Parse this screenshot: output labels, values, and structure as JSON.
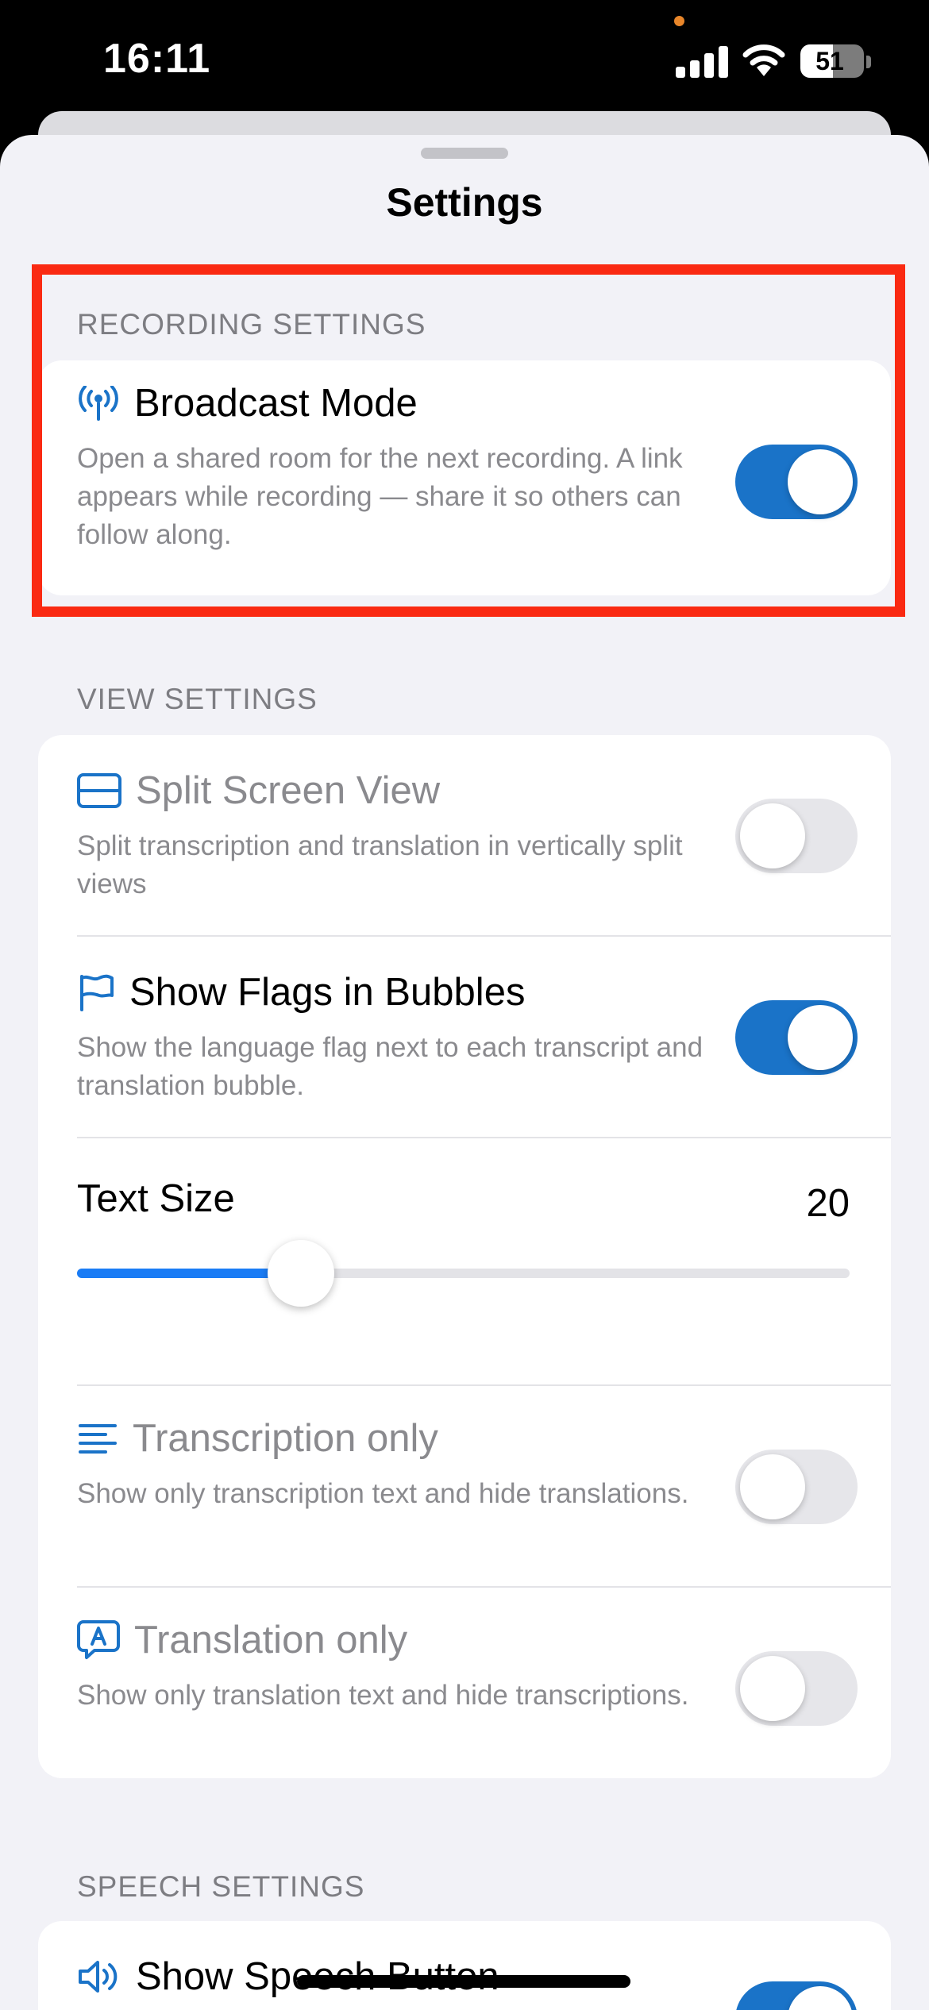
{
  "status_bar": {
    "time": "16:11",
    "battery": "51",
    "battery_level": 0.51
  },
  "sheet": {
    "title": "Settings"
  },
  "recording_settings": {
    "header": "RECORDING SETTINGS",
    "broadcast_mode": {
      "icon": "antenna-icon",
      "title": "Broadcast Mode",
      "description": "Open a shared room for the next recording. A link appears while recording — share it so others can follow along.",
      "enabled": true
    }
  },
  "view_settings": {
    "header": "VIEW SETTINGS",
    "split_screen": {
      "icon": "split-view-icon",
      "title": "Split Screen View",
      "description": "Split transcription and translation in vertically split views",
      "enabled": false
    },
    "show_flags": {
      "icon": "flag-icon",
      "title": "Show Flags in Bubbles",
      "description": "Show the language flag next to each transcript and translation bubble.",
      "enabled": true
    },
    "text_size": {
      "label": "Text Size",
      "value": "20",
      "slider_fraction": 0.29
    },
    "transcription_only": {
      "icon": "text-lines-icon",
      "title": "Transcription only",
      "description": "Show only transcription text and hide translations.",
      "enabled": false
    },
    "translation_only": {
      "icon": "translate-bubble-icon",
      "title": "Translation only",
      "description": "Show only translation text and hide transcriptions.",
      "enabled": false
    }
  },
  "speech_settings": {
    "header": "SPEECH SETTINGS",
    "show_speech_button": {
      "icon": "speaker-icon",
      "title": "Show Speech Button",
      "enabled": true
    }
  },
  "colors": {
    "accent": "#1a73c8",
    "slider": "#1a7cf5",
    "highlight": "#fa2a12",
    "secondary_text": "#8a8a8e"
  }
}
